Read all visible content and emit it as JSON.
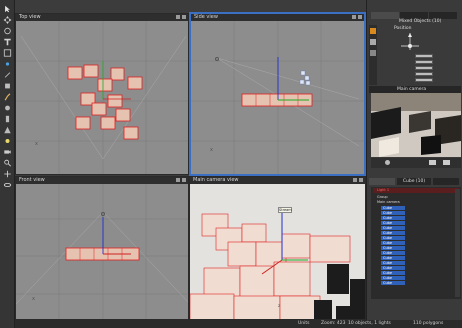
{
  "viewports": {
    "top": {
      "title": "Top view"
    },
    "side": {
      "title": "Side view"
    },
    "front": {
      "title": "Front view"
    },
    "camera": {
      "title": "Main camera view",
      "tooltip": "Stream",
      "axis_label": "z"
    }
  },
  "right_panel": {
    "tabs": [
      "",
      "",
      ""
    ],
    "object_title": "Mixed Objects (10)",
    "position_label": "Position",
    "camera_title": "Main camera",
    "lower_tabs": [
      "",
      "Cube (10)",
      ""
    ],
    "tree_root": "Light 1",
    "tree_items": [
      "Group",
      "Main camera"
    ],
    "cube_items": [
      "Cube",
      "Cube",
      "Cube",
      "Cube",
      "Cube",
      "Cube",
      "Cube",
      "Cube",
      "Cube",
      "Cube",
      "Cube",
      "Cube",
      "Cube",
      "Cube",
      "Cube",
      "Cube"
    ]
  },
  "status": {
    "units": "Units",
    "zoom": "Zoom: 423",
    "objects": "10 objects, 1 lights",
    "polygons": "110 polygons"
  },
  "colors": {
    "accent": "#3b6fc4",
    "selection": "#e02020",
    "viewport_bg": "#8d8d8d",
    "cube_fill": "#e6c2b0"
  }
}
